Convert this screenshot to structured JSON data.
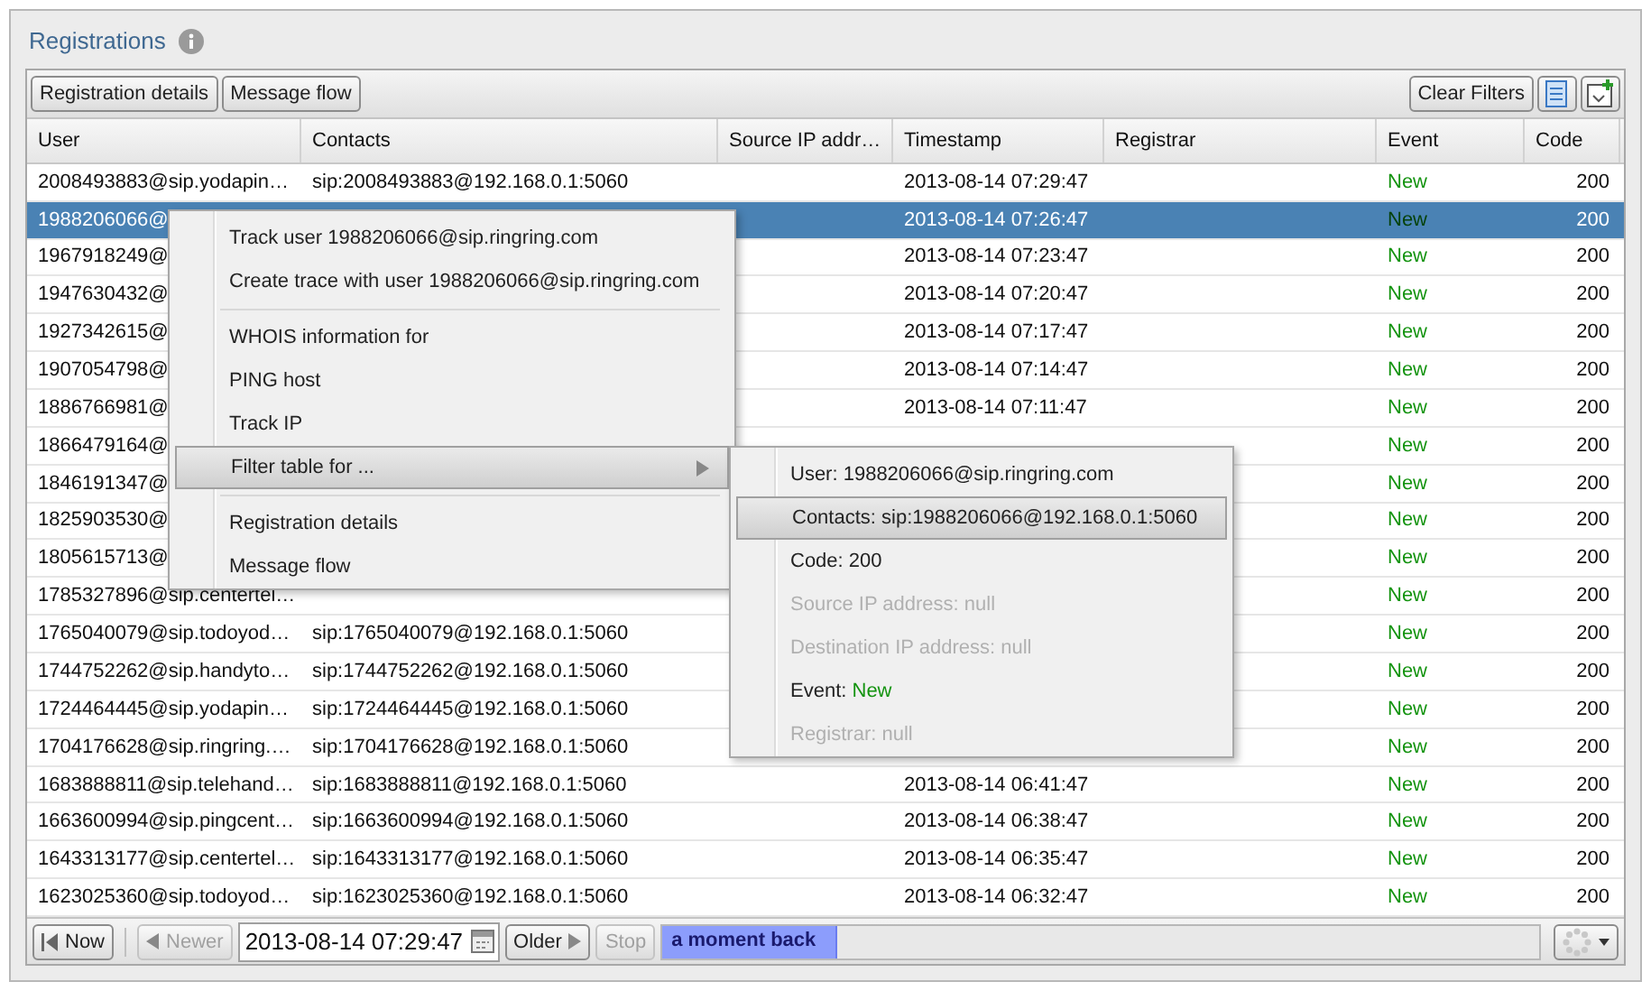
{
  "panel": {
    "title": "Registrations"
  },
  "toolbar": {
    "left_buttons": [
      "Registration details",
      "Message flow"
    ],
    "right_button": "Clear Filters"
  },
  "table": {
    "columns": [
      "User",
      "Contacts",
      "Source IP addr…",
      "Timestamp",
      "Registrar",
      "Event",
      "Code"
    ],
    "rows": [
      {
        "user": "2008493883@sip.yodapin…",
        "contacts": "sip:2008493883@192.168.0.1:5060",
        "timestamp": "2013-08-14 07:29:47",
        "event": "New",
        "code": "200",
        "selected": false
      },
      {
        "user": "1988206066@",
        "timestamp": "2013-08-14 07:26:47",
        "event": "New",
        "code": "200",
        "selected": true
      },
      {
        "user": "1967918249@",
        "timestamp": "2013-08-14 07:23:47",
        "event": "New",
        "code": "200",
        "selected": false
      },
      {
        "user": "1947630432@",
        "timestamp": "2013-08-14 07:20:47",
        "event": "New",
        "code": "200",
        "selected": false
      },
      {
        "user": "1927342615@",
        "timestamp": "2013-08-14 07:17:47",
        "event": "New",
        "code": "200",
        "selected": false
      },
      {
        "user": "1907054798@",
        "timestamp": "2013-08-14 07:14:47",
        "event": "New",
        "code": "200",
        "selected": false
      },
      {
        "user": "1886766981@",
        "timestamp": "2013-08-14 07:11:47",
        "event": "New",
        "code": "200",
        "selected": false
      },
      {
        "user": "1866479164@",
        "event": "New",
        "code": "200",
        "selected": false
      },
      {
        "user": "1846191347@",
        "event": "New",
        "code": "200",
        "selected": false
      },
      {
        "user": "1825903530@",
        "event": "New",
        "code": "200",
        "selected": false
      },
      {
        "user": "1805615713@",
        "event": "New",
        "code": "200",
        "selected": false
      },
      {
        "user": "1785327896@sip.centertel…",
        "event": "New",
        "code": "200",
        "selected": false
      },
      {
        "user": "1765040079@sip.todoyod…",
        "contacts": "sip:1765040079@192.168.0.1:5060",
        "event": "New",
        "code": "200",
        "selected": false
      },
      {
        "user": "1744752262@sip.handyto…",
        "contacts": "sip:1744752262@192.168.0.1:5060",
        "event": "New",
        "code": "200",
        "selected": false
      },
      {
        "user": "1724464445@sip.yodapin…",
        "contacts": "sip:1724464445@192.168.0.1:5060",
        "event": "New",
        "code": "200",
        "selected": false
      },
      {
        "user": "1704176628@sip.ringring.…",
        "contacts": "sip:1704176628@192.168.0.1:5060",
        "event": "New",
        "code": "200",
        "selected": false
      },
      {
        "user": "1683888811@sip.telehand…",
        "contacts": "sip:1683888811@192.168.0.1:5060",
        "timestamp": "2013-08-14 06:41:47",
        "event": "New",
        "code": "200",
        "selected": false
      },
      {
        "user": "1663600994@sip.pingcent…",
        "contacts": "sip:1663600994@192.168.0.1:5060",
        "timestamp": "2013-08-14 06:38:47",
        "event": "New",
        "code": "200",
        "selected": false
      },
      {
        "user": "1643313177@sip.centertel…",
        "contacts": "sip:1643313177@192.168.0.1:5060",
        "timestamp": "2013-08-14 06:35:47",
        "event": "New",
        "code": "200",
        "selected": false
      },
      {
        "user": "1623025360@sip.todoyod…",
        "contacts": "sip:1623025360@192.168.0.1:5060",
        "timestamp": "2013-08-14 06:32:47",
        "event": "New",
        "code": "200",
        "selected": false
      }
    ]
  },
  "context_menu": {
    "groups": [
      [
        {
          "label": "Track user 1988206066@sip.ringring.com",
          "selected": false
        },
        {
          "label": "Create trace with user 1988206066@sip.ringring.com",
          "selected": false
        }
      ],
      [
        {
          "label": "WHOIS information for",
          "selected": false
        },
        {
          "label": "PING host",
          "selected": false
        },
        {
          "label": "Track IP",
          "selected": false
        },
        {
          "label": "Filter table for ...",
          "selected": true,
          "submenu": true
        }
      ],
      [
        {
          "label": "Registration details",
          "selected": false
        },
        {
          "label": "Message flow",
          "selected": false
        }
      ]
    ]
  },
  "submenu": {
    "items": [
      {
        "label": "User: 1988206066@sip.ringring.com",
        "selected": false,
        "disabled": false
      },
      {
        "label": "Contacts: sip:1988206066@192.168.0.1:5060",
        "selected": true,
        "disabled": false
      },
      {
        "label": "Code: 200",
        "selected": false,
        "disabled": false
      },
      {
        "label": "Source IP address: null",
        "selected": false,
        "disabled": true
      },
      {
        "label": "Destination IP address: null",
        "selected": false,
        "disabled": true
      },
      {
        "label": "Event:",
        "value": "New",
        "selected": false,
        "disabled": false
      },
      {
        "label": "Registrar: null",
        "selected": false,
        "disabled": true
      }
    ]
  },
  "bottom_bar": {
    "now": "Now",
    "newer": {
      "label": "Newer",
      "disabled": true
    },
    "date": "2013-08-14 07:29:47",
    "older": {
      "label": "Older",
      "disabled": false
    },
    "stop": {
      "label": "Stop",
      "disabled": true
    },
    "progress": {
      "label": "a moment back",
      "level": 0.2
    }
  }
}
